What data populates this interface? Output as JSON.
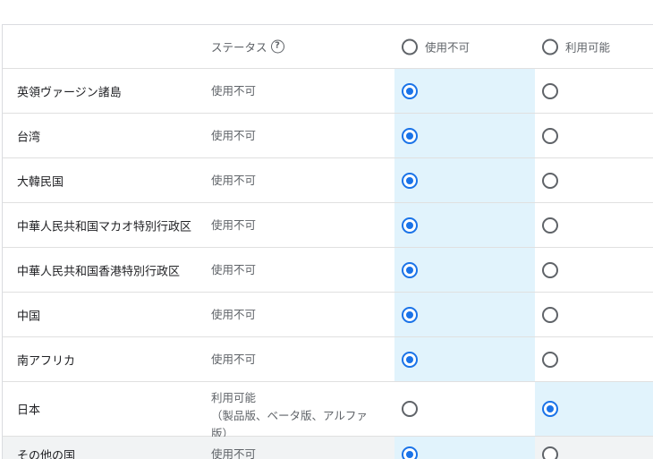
{
  "header": {
    "status_label": "ステータス",
    "help_icon": "?",
    "col_unavailable": "使用不可",
    "col_available": "利用可能"
  },
  "rows": [
    {
      "country": "英領ヴァージン諸島",
      "status": "使用不可",
      "selected": "unavailable"
    },
    {
      "country": "台湾",
      "status": "使用不可",
      "selected": "unavailable"
    },
    {
      "country": "大韓民国",
      "status": "使用不可",
      "selected": "unavailable"
    },
    {
      "country": "中華人民共和国マカオ特別行政区",
      "status": "使用不可",
      "selected": "unavailable"
    },
    {
      "country": "中華人民共和国香港特別行政区",
      "status": "使用不可",
      "selected": "unavailable"
    },
    {
      "country": "中国",
      "status": "使用不可",
      "selected": "unavailable"
    },
    {
      "country": "南アフリカ",
      "status": "使用不可",
      "selected": "unavailable"
    },
    {
      "country": "日本",
      "status_line1": "利用可能",
      "status_line2": "（製品版、ベータ版、アルファ",
      "status_line3": "版）",
      "selected": "available"
    },
    {
      "country": "その他の国",
      "status": "使用不可",
      "selected": "unavailable"
    }
  ],
  "colors": {
    "accent": "#1a73e8",
    "highlight": "#e1f3fc",
    "last_row_bg": "#f1f3f4"
  }
}
